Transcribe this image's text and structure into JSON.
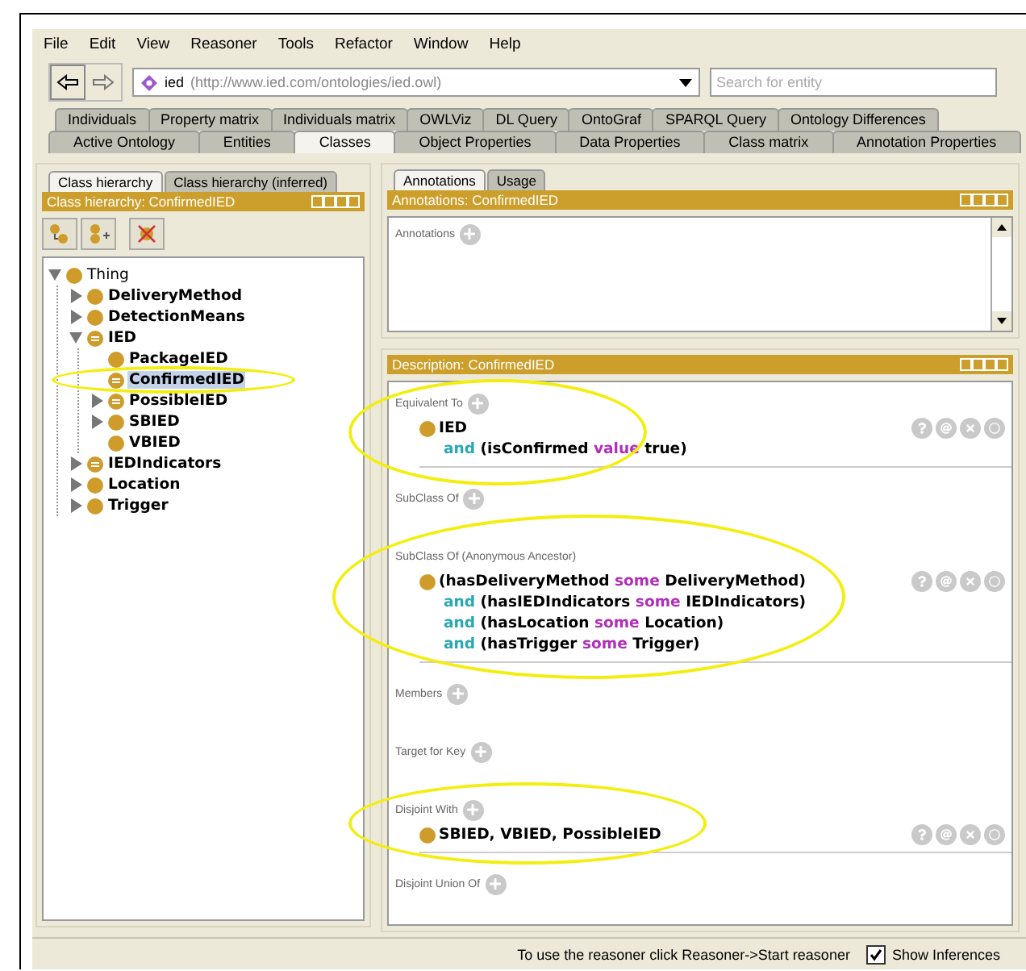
{
  "menu": [
    "File",
    "Edit",
    "View",
    "Reasoner",
    "Tools",
    "Refactor",
    "Window",
    "Help"
  ],
  "toolbar": {
    "ontology_name": "ied",
    "ontology_iri": "(http://www.ied.com/ontologies/ied.owl)",
    "search": {
      "placeholder": "Search for entity"
    }
  },
  "tab_rows": [
    [
      {
        "label": "Individuals",
        "selected": false
      },
      {
        "label": "Property matrix",
        "selected": false
      },
      {
        "label": "Individuals matrix",
        "selected": false
      },
      {
        "label": "OWLViz",
        "selected": false
      },
      {
        "label": "DL Query",
        "selected": false
      },
      {
        "label": "OntoGraf",
        "selected": false
      },
      {
        "label": "SPARQL Query",
        "selected": false
      },
      {
        "label": "Ontology Differences",
        "selected": false
      }
    ],
    [
      {
        "label": "Active Ontology",
        "selected": false
      },
      {
        "label": "Entities",
        "selected": false
      },
      {
        "label": "Classes",
        "selected": true
      },
      {
        "label": "Object Properties",
        "selected": false
      },
      {
        "label": "Data Properties",
        "selected": false
      },
      {
        "label": "Class matrix",
        "selected": false
      },
      {
        "label": "Annotation Properties",
        "selected": false
      }
    ]
  ],
  "class_hierarchy": {
    "tabs": [
      {
        "label": "Class hierarchy",
        "selected": true
      },
      {
        "label": "Class hierarchy (inferred)",
        "selected": false
      }
    ],
    "title": "Class hierarchy: ConfirmedIED",
    "tree": [
      {
        "label": "Thing",
        "kind": "primitive",
        "expanded": true,
        "selected": false,
        "highlighted": false,
        "children": [
          {
            "label": "DeliveryMethod",
            "kind": "primitive",
            "expanded": false,
            "selected": false,
            "highlighted": false
          },
          {
            "label": "DetectionMeans",
            "kind": "primitive",
            "expanded": false,
            "selected": false,
            "highlighted": false
          },
          {
            "label": "IED",
            "kind": "defined",
            "expanded": true,
            "selected": false,
            "highlighted": false,
            "children": [
              {
                "label": "PackageIED",
                "kind": "primitive",
                "selected": false,
                "highlighted": false
              },
              {
                "label": "ConfirmedIED",
                "kind": "defined",
                "selected": true,
                "highlighted": true
              },
              {
                "label": "PossibleIED",
                "kind": "defined",
                "expanded": false,
                "selected": false,
                "highlighted": false
              },
              {
                "label": "SBIED",
                "kind": "primitive",
                "expanded": false,
                "selected": false,
                "highlighted": false
              },
              {
                "label": "VBIED",
                "kind": "primitive",
                "selected": false,
                "highlighted": false
              }
            ]
          },
          {
            "label": "IEDIndicators",
            "kind": "defined",
            "expanded": false,
            "selected": false,
            "highlighted": false
          },
          {
            "label": "Location",
            "kind": "primitive",
            "expanded": false,
            "selected": false,
            "highlighted": false
          },
          {
            "label": "Trigger",
            "kind": "primitive",
            "expanded": false,
            "selected": false,
            "highlighted": false
          }
        ]
      }
    ]
  },
  "annotations_panel": {
    "tabs": [
      {
        "label": "Annotations",
        "selected": true
      },
      {
        "label": "Usage",
        "selected": false
      }
    ],
    "title": "Annotations: ConfirmedIED",
    "section": "Annotations"
  },
  "description_panel": {
    "title": "Description: ConfirmedIED",
    "sections": [
      {
        "label": "Equivalent To",
        "addable": true,
        "highlighted": true,
        "entries": [
          {
            "lines": [
              [
                {
                  "kind": "name",
                  "text": "IED"
                }
              ],
              [
                {
                  "kind": "keyword",
                  "text": "and"
                },
                {
                  "kind": "name",
                  "text": " (isConfirmed "
                },
                {
                  "kind": "restriction",
                  "text": "value"
                },
                {
                  "kind": "name",
                  "text": " true)"
                }
              ]
            ]
          }
        ]
      },
      {
        "label": "SubClass Of",
        "addable": true,
        "highlighted": false
      },
      {
        "label": "SubClass Of (Anonymous Ancestor)",
        "addable": false,
        "highlighted": true,
        "entries": [
          {
            "lines": [
              [
                {
                  "kind": "name",
                  "text": "(hasDeliveryMethod "
                },
                {
                  "kind": "restriction",
                  "text": "some"
                },
                {
                  "kind": "name",
                  "text": " DeliveryMethod)"
                }
              ],
              [
                {
                  "kind": "keyword",
                  "text": "and"
                },
                {
                  "kind": "name",
                  "text": " (hasIEDIndicators "
                },
                {
                  "kind": "restriction",
                  "text": "some"
                },
                {
                  "kind": "name",
                  "text": " IEDIndicators)"
                }
              ],
              [
                {
                  "kind": "keyword",
                  "text": "and"
                },
                {
                  "kind": "name",
                  "text": " (hasLocation "
                },
                {
                  "kind": "restriction",
                  "text": "some"
                },
                {
                  "kind": "name",
                  "text": " Location)"
                }
              ],
              [
                {
                  "kind": "keyword",
                  "text": "and"
                },
                {
                  "kind": "name",
                  "text": " (hasTrigger "
                },
                {
                  "kind": "restriction",
                  "text": "some"
                },
                {
                  "kind": "name",
                  "text": " Trigger)"
                }
              ]
            ]
          }
        ]
      },
      {
        "label": "Members",
        "addable": true,
        "highlighted": false
      },
      {
        "label": "Target for Key",
        "addable": true,
        "highlighted": false
      },
      {
        "label": "Disjoint With",
        "addable": true,
        "highlighted": true,
        "entries": [
          {
            "lines": [
              [
                {
                  "kind": "name",
                  "text": "SBIED, VBIED, PossibleIED"
                }
              ]
            ]
          }
        ]
      },
      {
        "label": "Disjoint Union Of",
        "addable": true,
        "highlighted": false
      }
    ]
  },
  "status_bar": {
    "message": "To use the reasoner click Reasoner->Start reasoner",
    "show_inferences": {
      "label": "Show Inferences",
      "checked": true
    }
  }
}
